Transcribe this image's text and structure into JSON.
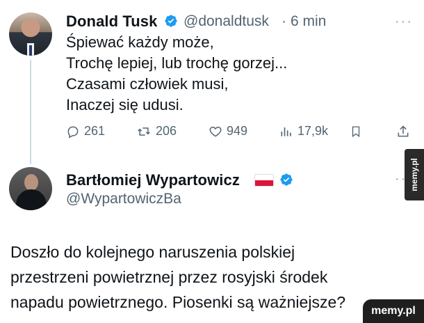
{
  "tweet1": {
    "name": "Donald Tusk",
    "handle": "@donaldtusk",
    "separator": "·",
    "time": "6 min",
    "text": "Śpiewać każdy może,\nTrochę lepiej, lub trochę gorzej...\nCzasami człowiek musi,\nInaczej się udusi.",
    "actions": {
      "replies": "261",
      "reposts": "206",
      "likes": "949",
      "views": "17,9k"
    },
    "more": "···"
  },
  "tweet2": {
    "name": "Bartłomiej Wypartowicz",
    "handle": "@WypartowiczBa",
    "more": "···",
    "text": "Doszło do kolejnego naruszenia polskiej\nprzestrzeni powietrznej przez rosyjski środek\nnapadu powietrznego. Piosenki są ważniejsze?"
  },
  "watermarks": {
    "side": "memy.pl",
    "bottom": "memy.pl"
  },
  "icons": {
    "verified": "verified-badge-icon",
    "reply": "reply-icon",
    "repost": "repost-icon",
    "like": "like-icon",
    "views": "views-icon",
    "bookmark": "bookmark-icon",
    "share": "share-icon"
  },
  "colors": {
    "verified": "#1d9bf0",
    "muted": "#536471",
    "text": "#0f1419",
    "thread_line": "#cfd9de"
  }
}
